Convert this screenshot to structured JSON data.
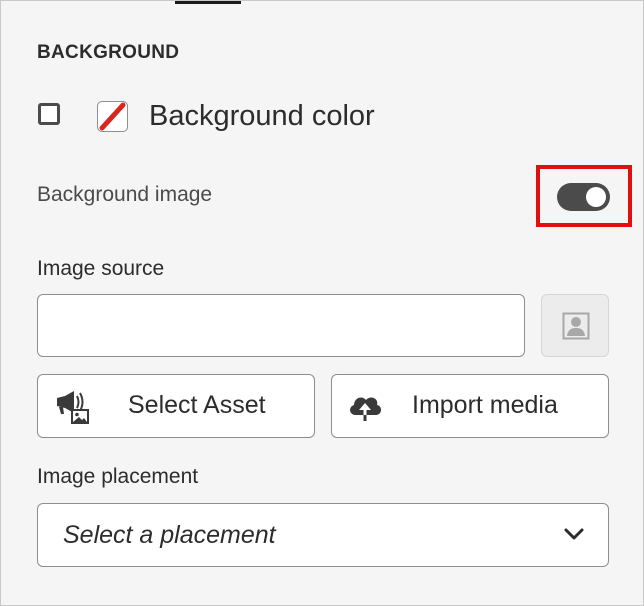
{
  "panel": {
    "section_title": "BACKGROUND",
    "background_color": {
      "label": "Background color",
      "checked": false,
      "swatch_state": "none"
    },
    "background_image": {
      "label": "Background image",
      "enabled": true
    },
    "image_source": {
      "label": "Image source",
      "value": "",
      "browse_icon": "image-browse-icon"
    },
    "buttons": {
      "select_asset": {
        "label": "Select Asset",
        "icon": "asset-icon"
      },
      "import_media": {
        "label": "Import media",
        "icon": "cloud-upload-icon"
      }
    },
    "image_placement": {
      "label": "Image placement",
      "selected": "Select a placement"
    }
  },
  "colors": {
    "highlight": "#e01010",
    "toggle_on": "#4b4b4b",
    "swatch_slash": "#d7261e"
  }
}
